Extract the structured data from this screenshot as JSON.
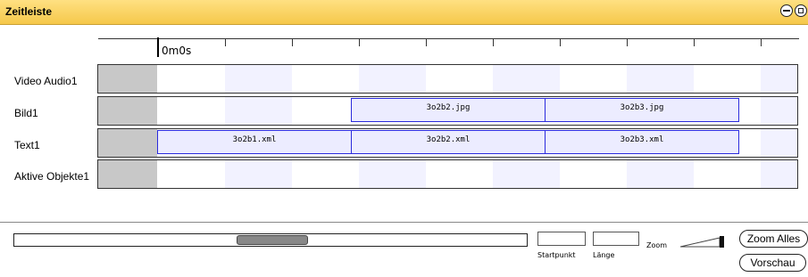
{
  "title": "Zeitleiste",
  "ruler": {
    "start_label": "0m0s"
  },
  "tracks": [
    {
      "label": "Video Audio1",
      "clips": []
    },
    {
      "label": "Bild1",
      "clips": [
        "3o2b2.jpg",
        "3o2b3.jpg"
      ]
    },
    {
      "label": "Text1",
      "clips": [
        "3o2b1.xml",
        "3o2b2.xml",
        "3o2b3.xml"
      ]
    },
    {
      "label": "Aktive Objekte1",
      "clips": []
    }
  ],
  "controls": {
    "startpunkt_label": "Startpunkt",
    "laenge_label": "Länge",
    "zoom_label": "Zoom",
    "zoom_alles_label": "Zoom Alles",
    "vorschau_label": "Vorschau"
  },
  "icons": {
    "minimize": "minimize-icon",
    "restore": "restore-icon"
  },
  "colors": {
    "titlebar": "#f5c84a",
    "clip_border": "#2b2bdd",
    "clip_fill": "#ececff"
  }
}
